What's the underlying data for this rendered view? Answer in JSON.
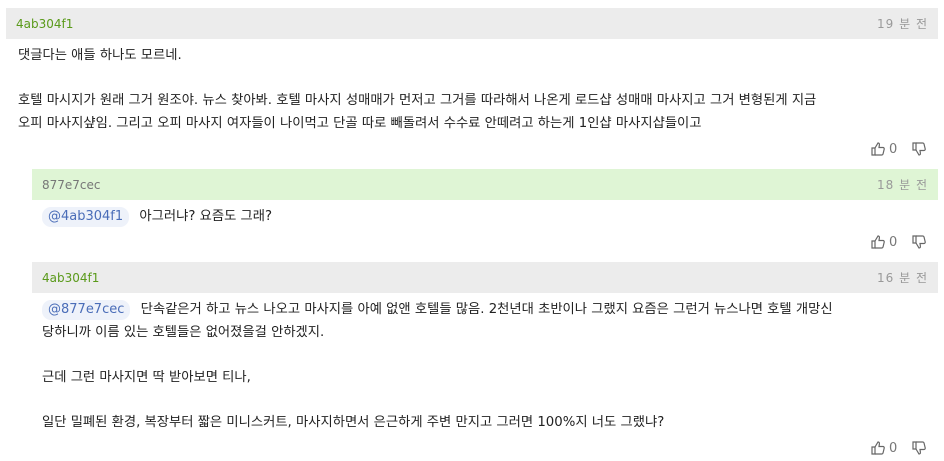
{
  "comments": [
    {
      "user": "4ab304f1",
      "time": "19 분 전",
      "lines": [
        "댓글다는 애들 하나도 모르네.",
        "",
        "호텔 마시지가 원래 그거 원조야. 뉴스 찾아봐. 호텔 마사지 성매매가 먼저고 그거를 따라해서 나온게 로드샵 성매매 마사지고 그거 변형된게 지금",
        "오피 마사지샾임. 그리고 오피 마사지 여자들이 나이먹고 단골 따로 빼돌려서 수수료 안떼려고 하는게 1인샵 마사지샵들이고"
      ],
      "likes": "0"
    },
    {
      "user": "877e7cec",
      "time": "18 분 전",
      "mention": "@4ab304f1",
      "lines": [
        "아그러냐? 요즘도 그래?"
      ],
      "likes": "0"
    },
    {
      "user": "4ab304f1",
      "time": "16 분 전",
      "mention": "@877e7cec",
      "lines": [
        "단속같은거 하고 뉴스 나오고 마사지를 아예 없앤 호텔들 많음. 2천년대 초반이나 그랬지 요즘은 그런거 뉴스나면 호텔 개망신",
        "당하니까 이름 있는 호텔들은 없어졌을걸 안하겠지.",
        "",
        "근데 그런 마사지면 딱 받아보면 티나,",
        "",
        "일단 밀폐된 환경, 복장부터 짧은 미니스커트, 마사지하면서 은근하게 주변 만지고 그러면 100%지 너도 그랬냐?"
      ],
      "likes": "0"
    }
  ],
  "icons": {
    "like": "thumbs-up-icon",
    "dislike": "thumbs-down-icon"
  }
}
